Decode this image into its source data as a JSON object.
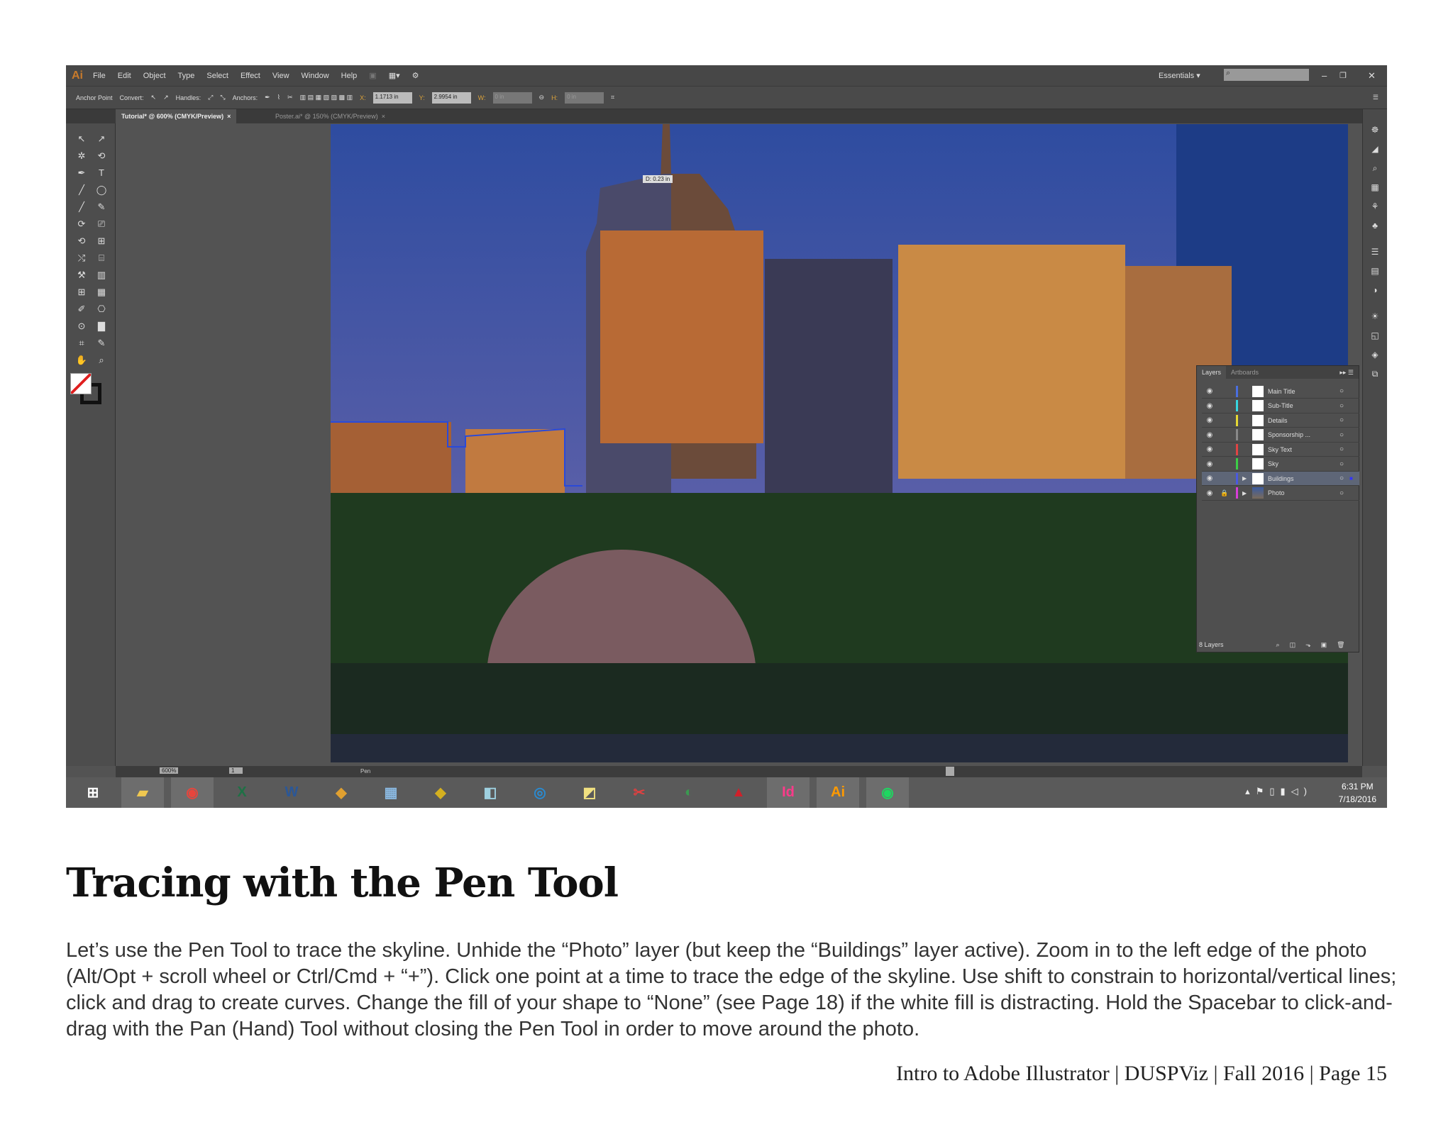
{
  "app": {
    "logo": "Ai",
    "menu": [
      "File",
      "Edit",
      "Object",
      "Type",
      "Select",
      "Effect",
      "View",
      "Window",
      "Help"
    ],
    "workspace": "Essentials ▾",
    "window_controls": [
      "–",
      "❐",
      "✕"
    ]
  },
  "control_bar": {
    "anchor_point": "Anchor Point",
    "convert": "Convert:",
    "handles": "Handles:",
    "anchors": "Anchors:",
    "x_label": "X:",
    "x_value": "1.1713 in",
    "y_label": "Y:",
    "y_value": "2.9954 in",
    "w_label": "W:",
    "w_value": "0 in",
    "h_label": "H:",
    "h_value": "0 in"
  },
  "tabs": [
    {
      "label": "Tutorial* @ 600% (CMYK/Preview)",
      "close": "×"
    },
    {
      "label": "Poster.ai* @ 150% (CMYK/Preview)",
      "close": "×"
    }
  ],
  "canvas": {
    "tooltip": "D: 0.23 in"
  },
  "layers_panel": {
    "tabs": [
      "Layers",
      "Artboards"
    ],
    "layers": [
      {
        "name": "Main Title",
        "color": "#4a6fe0"
      },
      {
        "name": "Sub-Title",
        "color": "#36d6e0"
      },
      {
        "name": "Details",
        "color": "#e5d834"
      },
      {
        "name": "Sponsorship ...",
        "color": "#888888"
      },
      {
        "name": "Sky Text",
        "color": "#e04444"
      },
      {
        "name": "Sky",
        "color": "#3ccf47"
      },
      {
        "name": "Buildings",
        "color": "#4a5ae0",
        "selected": true
      },
      {
        "name": "Photo",
        "color": "#d83ed8",
        "locked": true
      }
    ],
    "count": "8 Layers"
  },
  "status_bar": {
    "zoom": "600%",
    "artboard": "1",
    "tool": "Pen"
  },
  "taskbar": {
    "apps": [
      "windows-start",
      "file-explorer",
      "chrome",
      "excel",
      "word",
      "app-5",
      "calculator",
      "app-7",
      "app-8",
      "search-app",
      "sticky-notes",
      "snipping",
      "app-12",
      "acrobat",
      "indesign",
      "illustrator",
      "spotify"
    ],
    "time": "6:31 PM",
    "date": "7/18/2016"
  },
  "doc": {
    "heading": "Tracing with the Pen Tool",
    "body": "Let’s use the Pen Tool to trace the skyline. Unhide the “Photo” layer (but keep the “Buildings” layer active). Zoom in to the left edge of the photo (Alt/Opt + scroll wheel or Ctrl/Cmd + “+”). Click one point at a time to trace the edge of the skyline. Use shift to constrain to horizontal/vertical lines; click and drag to create curves. Change the fill of your shape to “None” (see Page 18) if the white fill is distracting. Hold the Spacebar to click-and-drag with the Pan (Hand) Tool without closing the Pen Tool in order to move around the photo.",
    "footer": "Intro to Adobe Illustrator | DUSPViz | Fall 2016 | Page 15"
  }
}
